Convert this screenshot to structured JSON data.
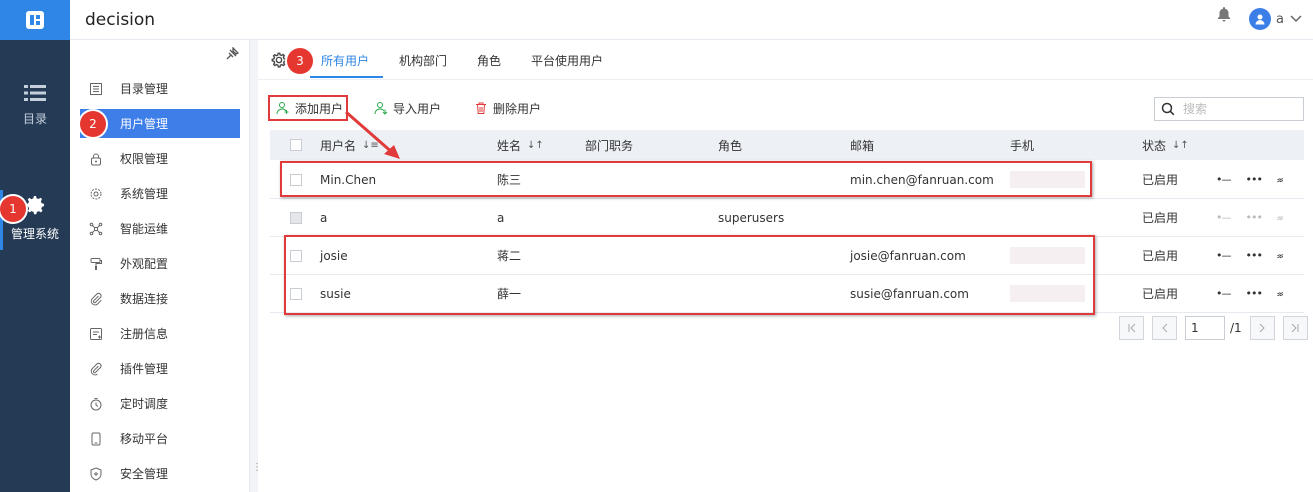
{
  "app": {
    "title": "decision"
  },
  "topbar": {
    "user_name": "a"
  },
  "rail": {
    "items": [
      {
        "label": "目录",
        "icon": "list-icon"
      },
      {
        "label": "管理系统",
        "icon": "gear-icon"
      }
    ]
  },
  "sidebar": {
    "items": [
      {
        "label": "目录管理",
        "icon": "catalog-icon"
      },
      {
        "label": "用户管理",
        "icon": "user-icon"
      },
      {
        "label": "权限管理",
        "icon": "lock-icon"
      },
      {
        "label": "系统管理",
        "icon": "gear-icon"
      },
      {
        "label": "智能运维",
        "icon": "network-icon"
      },
      {
        "label": "外观配置",
        "icon": "paint-roller-icon"
      },
      {
        "label": "数据连接",
        "icon": "link-icon"
      },
      {
        "label": "注册信息",
        "icon": "register-icon"
      },
      {
        "label": "插件管理",
        "icon": "plugin-icon"
      },
      {
        "label": "定时调度",
        "icon": "timer-icon"
      },
      {
        "label": "移动平台",
        "icon": "mobile-icon"
      },
      {
        "label": "安全管理",
        "icon": "shield-icon"
      }
    ]
  },
  "tabs": [
    {
      "label": "所有用户"
    },
    {
      "label": "机构部门"
    },
    {
      "label": "角色"
    },
    {
      "label": "平台使用用户"
    }
  ],
  "actions": {
    "add_user": "添加用户",
    "import_user": "导入用户",
    "delete_user": "删除用户",
    "search_placeholder": "搜索"
  },
  "table": {
    "headers": {
      "username": "用户名",
      "name": "姓名",
      "dept": "部门职务",
      "role": "角色",
      "email": "邮箱",
      "phone": "手机",
      "status": "状态"
    },
    "rows": [
      {
        "username": "Min.Chen",
        "name": "陈三",
        "dept": "",
        "role": "",
        "email": "min.chen@fanruan.com",
        "status": "已启用"
      },
      {
        "username": "a",
        "name": "a",
        "dept": "",
        "role": "superusers",
        "email": "",
        "status": "已启用"
      },
      {
        "username": "josie",
        "name": "蒋二",
        "dept": "",
        "role": "",
        "email": "josie@fanruan.com",
        "status": "已启用"
      },
      {
        "username": "susie",
        "name": "薛一",
        "dept": "",
        "role": "",
        "email": "susie@fanruan.com",
        "status": "已启用"
      }
    ]
  },
  "pagination": {
    "current": "1",
    "total": "/1"
  },
  "annotations": {
    "badge1": "1",
    "badge2": "2",
    "badge3": "3"
  },
  "colors": {
    "accent": "#2f86e6",
    "rail_bg": "#243a55",
    "annotation_red": "#e03a3a"
  }
}
